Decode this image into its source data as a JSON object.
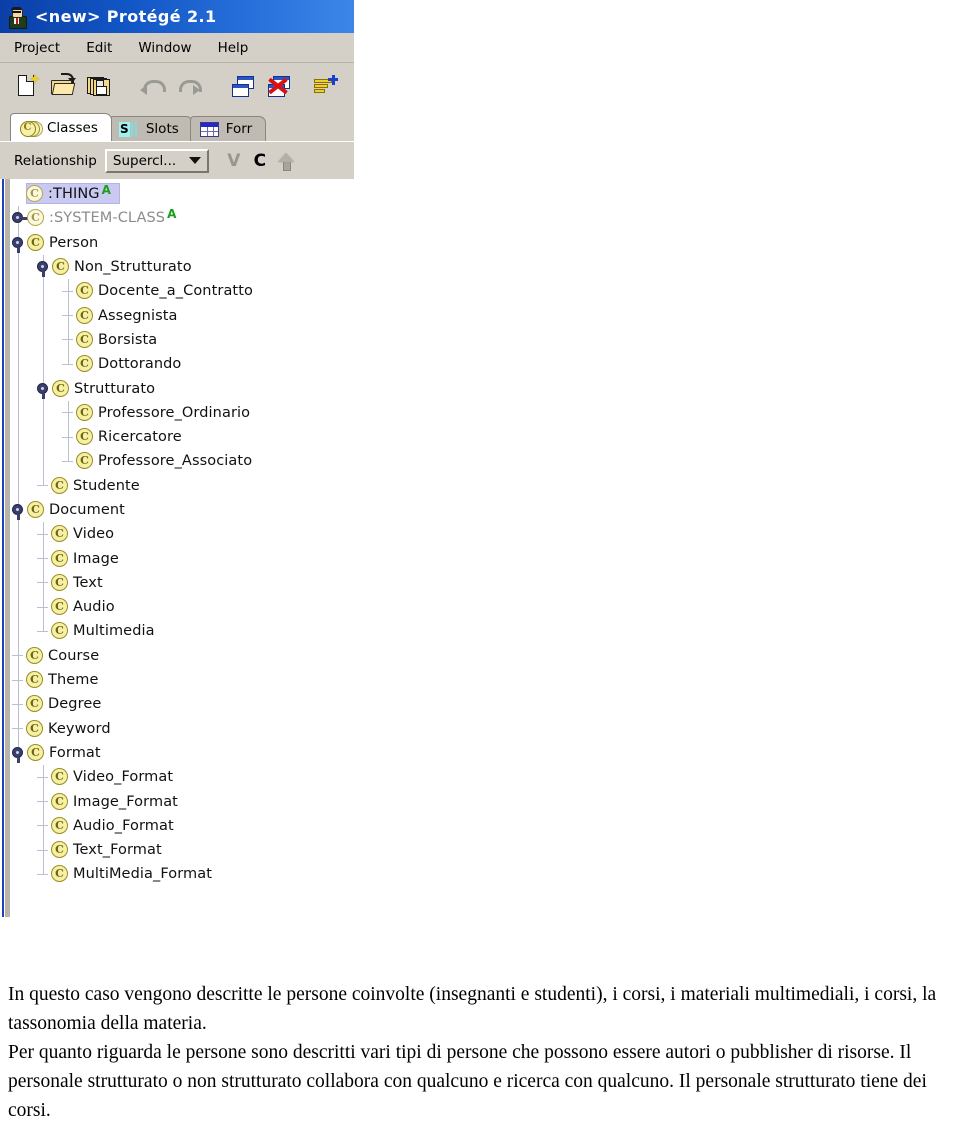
{
  "window": {
    "title": "<new>  Protégé 2.1",
    "app_icon": "professor-icon"
  },
  "menubar": {
    "items": [
      {
        "label": "Project"
      },
      {
        "label": "Edit"
      },
      {
        "label": "Window"
      },
      {
        "label": "Help"
      }
    ]
  },
  "toolbar": {
    "buttons": [
      {
        "name": "new-project-icon",
        "title": "New Project"
      },
      {
        "name": "open-project-icon",
        "title": "Open Project"
      },
      {
        "name": "save-project-icon",
        "title": "Save Project"
      },
      {
        "name": "undo-icon",
        "title": "Undo"
      },
      {
        "name": "redo-icon",
        "title": "Redo"
      },
      {
        "name": "manage-windows-icon",
        "title": "Manage Windows"
      },
      {
        "name": "close-windows-icon",
        "title": "Close All Windows"
      },
      {
        "name": "configure-tabs-icon",
        "title": "Configure Tabs"
      }
    ]
  },
  "tabs": [
    {
      "label": "Classes",
      "icon": "classes-icon",
      "active": true
    },
    {
      "label": "Slots",
      "icon": "slots-icon",
      "active": false
    },
    {
      "label": "Forr",
      "icon": "forms-icon",
      "active": false
    }
  ],
  "relationship_bar": {
    "label": "Relationship",
    "combo_value": "Supercl...",
    "actions": [
      {
        "name": "view-action",
        "label": "V",
        "enabled": false
      },
      {
        "name": "create-class-action",
        "label": "C",
        "enabled": true
      },
      {
        "name": "move-up-action",
        "label": "",
        "enabled": false
      }
    ]
  },
  "class_tree": {
    "nodes": [
      {
        "label": ":THING",
        "level": 0,
        "handle": "none",
        "selected": true,
        "abstract": true,
        "dim": false,
        "pale": true
      },
      {
        "label": ":SYSTEM-CLASS",
        "level": 0,
        "handle": "collapsed",
        "selected": false,
        "abstract": true,
        "dim": true,
        "pale": true
      },
      {
        "label": "Person",
        "level": 0,
        "handle": "expanded",
        "selected": false,
        "abstract": false,
        "dim": false,
        "pale": false
      },
      {
        "label": "Non_Strutturato",
        "level": 1,
        "handle": "expanded",
        "selected": false,
        "abstract": false,
        "dim": false,
        "pale": false
      },
      {
        "label": "Docente_a_Contratto",
        "level": 2,
        "handle": "leaf",
        "selected": false,
        "abstract": false,
        "dim": false,
        "pale": false
      },
      {
        "label": "Assegnista",
        "level": 2,
        "handle": "leaf",
        "selected": false,
        "abstract": false,
        "dim": false,
        "pale": false
      },
      {
        "label": "Borsista",
        "level": 2,
        "handle": "leaf",
        "selected": false,
        "abstract": false,
        "dim": false,
        "pale": false
      },
      {
        "label": "Dottorando",
        "level": 2,
        "handle": "leaf",
        "selected": false,
        "abstract": false,
        "dim": false,
        "pale": false
      },
      {
        "label": "Strutturato",
        "level": 1,
        "handle": "expanded",
        "selected": false,
        "abstract": false,
        "dim": false,
        "pale": false
      },
      {
        "label": "Professore_Ordinario",
        "level": 2,
        "handle": "leaf",
        "selected": false,
        "abstract": false,
        "dim": false,
        "pale": false
      },
      {
        "label": "Ricercatore",
        "level": 2,
        "handle": "leaf",
        "selected": false,
        "abstract": false,
        "dim": false,
        "pale": false
      },
      {
        "label": "Professore_Associato",
        "level": 2,
        "handle": "leaf",
        "selected": false,
        "abstract": false,
        "dim": false,
        "pale": false
      },
      {
        "label": "Studente",
        "level": 1,
        "handle": "leaf",
        "selected": false,
        "abstract": false,
        "dim": false,
        "pale": false
      },
      {
        "label": "Document",
        "level": 0,
        "handle": "expanded",
        "selected": false,
        "abstract": false,
        "dim": false,
        "pale": false
      },
      {
        "label": "Video",
        "level": 1,
        "handle": "leaf",
        "selected": false,
        "abstract": false,
        "dim": false,
        "pale": false
      },
      {
        "label": "Image",
        "level": 1,
        "handle": "leaf",
        "selected": false,
        "abstract": false,
        "dim": false,
        "pale": false
      },
      {
        "label": "Text",
        "level": 1,
        "handle": "leaf",
        "selected": false,
        "abstract": false,
        "dim": false,
        "pale": false
      },
      {
        "label": "Audio",
        "level": 1,
        "handle": "leaf",
        "selected": false,
        "abstract": false,
        "dim": false,
        "pale": false
      },
      {
        "label": "Multimedia",
        "level": 1,
        "handle": "leaf",
        "selected": false,
        "abstract": false,
        "dim": false,
        "pale": false
      },
      {
        "label": "Course",
        "level": 0,
        "handle": "leaf",
        "selected": false,
        "abstract": false,
        "dim": false,
        "pale": false
      },
      {
        "label": "Theme",
        "level": 0,
        "handle": "leaf",
        "selected": false,
        "abstract": false,
        "dim": false,
        "pale": false
      },
      {
        "label": "Degree",
        "level": 0,
        "handle": "leaf",
        "selected": false,
        "abstract": false,
        "dim": false,
        "pale": false
      },
      {
        "label": "Keyword",
        "level": 0,
        "handle": "leaf",
        "selected": false,
        "abstract": false,
        "dim": false,
        "pale": false
      },
      {
        "label": "Format",
        "level": 0,
        "handle": "expanded",
        "selected": false,
        "abstract": false,
        "dim": false,
        "pale": false
      },
      {
        "label": "Video_Format",
        "level": 1,
        "handle": "leaf",
        "selected": false,
        "abstract": false,
        "dim": false,
        "pale": false
      },
      {
        "label": "Image_Format",
        "level": 1,
        "handle": "leaf",
        "selected": false,
        "abstract": false,
        "dim": false,
        "pale": false
      },
      {
        "label": "Audio_Format",
        "level": 1,
        "handle": "leaf",
        "selected": false,
        "abstract": false,
        "dim": false,
        "pale": false
      },
      {
        "label": "Text_Format",
        "level": 1,
        "handle": "leaf",
        "selected": false,
        "abstract": false,
        "dim": false,
        "pale": false
      },
      {
        "label": "MultiMedia_Format",
        "level": 1,
        "handle": "leaf",
        "selected": false,
        "abstract": false,
        "dim": false,
        "pale": false
      }
    ]
  },
  "caption": {
    "paragraph1": "In questo caso vengono descritte le persone coinvolte (insegnanti e studenti), i corsi,  i materiali multimediali, i corsi, la tassonomia della materia.",
    "paragraph2": "Per quanto riguarda le persone sono descritti vari tipi di persone che possono essere autori o pubblisher di risorse. Il personale strutturato o non strutturato collabora con qualcuno e ricerca con qualcuno. Il personale strutturato tiene dei corsi."
  },
  "colors": {
    "titlebar_blue": "#1155c4",
    "chrome_gray": "#d4d0c8",
    "selection_lavender": "#c9c9f2",
    "class_icon_yellow": "#f6f0a6",
    "abstract_green": "#1aa11a",
    "connector_blue_gray": "#b9c0d4"
  }
}
